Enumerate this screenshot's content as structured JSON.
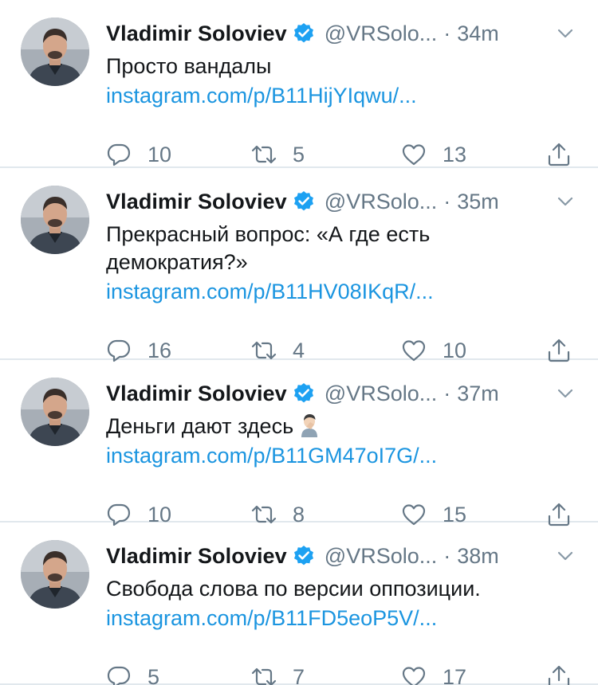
{
  "colors": {
    "name": "#14171a",
    "secondary": "#657786",
    "link": "#1b95e0",
    "verified": "#1da1f2",
    "divider": "#e1e8ed"
  },
  "icons": {
    "avatar": "profile-photo",
    "verified": "verified-badge-icon",
    "menu": "chevron-down-icon",
    "reply": "reply-icon",
    "retweet": "retweet-icon",
    "like": "heart-icon",
    "share": "share-icon"
  },
  "tweets": [
    {
      "name": "Vladimir Soloviev",
      "handle": "@VRSolo...",
      "separator": "·",
      "time": "34m",
      "text_lines": [
        "Просто вандалы"
      ],
      "emoji": "",
      "link": "instagram.com/p/B11HijYIqwu/...",
      "replies": "10",
      "retweets": "5",
      "likes": "13"
    },
    {
      "name": "Vladimir Soloviev",
      "handle": "@VRSolo...",
      "separator": "·",
      "time": "35m",
      "text_lines": [
        "Прекрасный вопрос: «А где есть",
        "демократия?»"
      ],
      "emoji": "",
      "link": "instagram.com/p/B11HV08IKqR/...",
      "replies": "16",
      "retweets": "4",
      "likes": "10"
    },
    {
      "name": "Vladimir Soloviev",
      "handle": "@VRSolo...",
      "separator": "·",
      "time": "37m",
      "text_lines": [
        "Деньги дают здесь"
      ],
      "emoji": "man-facepalming",
      "link": "instagram.com/p/B11GM47oI7G/...",
      "replies": "10",
      "retweets": "8",
      "likes": "15"
    },
    {
      "name": "Vladimir Soloviev",
      "handle": "@VRSolo...",
      "separator": "·",
      "time": "38m",
      "text_lines": [
        "Свобода слова по версии оппозиции."
      ],
      "emoji": "",
      "link": "instagram.com/p/B11FD5eoP5V/...",
      "replies": "5",
      "retweets": "7",
      "likes": "17"
    }
  ]
}
